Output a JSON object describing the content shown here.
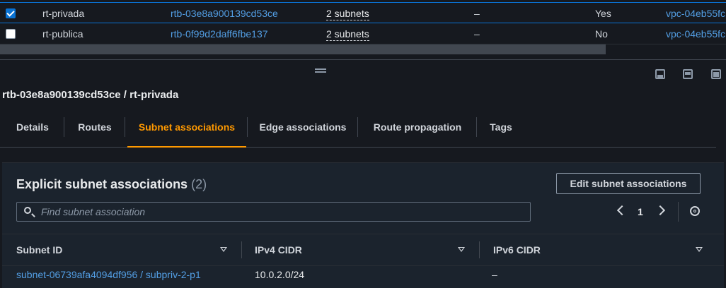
{
  "route_tables": [
    {
      "selected": true,
      "name": "rt-privada",
      "id": "rtb-03e8a900139cd53ce",
      "subnets": "2 subnets",
      "edge": "–",
      "main": "Yes",
      "vpc": "vpc-04eb55fc"
    },
    {
      "selected": false,
      "name": "rt-publica",
      "id": "rtb-0f99d2daff6fbe137",
      "subnets": "2 subnets",
      "edge": "–",
      "main": "No",
      "vpc": "vpc-04eb55fc"
    }
  ],
  "panel": {
    "title": "rtb-03e8a900139cd53ce / rt-privada"
  },
  "tabs": [
    "Details",
    "Routes",
    "Subnet associations",
    "Edge associations",
    "Route propagation",
    "Tags"
  ],
  "active_tab": "Subnet associations",
  "section": {
    "title": "Explicit subnet associations",
    "count": "(2)",
    "edit_button": "Edit subnet associations",
    "search_placeholder": "Find subnet association",
    "page": "1",
    "columns": [
      "Subnet ID",
      "IPv4 CIDR",
      "IPv6 CIDR"
    ],
    "rows": [
      {
        "subnet": "subnet-06739afa4094df956 / subpriv-2-p1",
        "ipv4": "10.0.2.0/24",
        "ipv6": "–"
      }
    ]
  },
  "colors": {
    "accent": "#ff9900",
    "link": "#539fe5",
    "background": "#16191f"
  }
}
